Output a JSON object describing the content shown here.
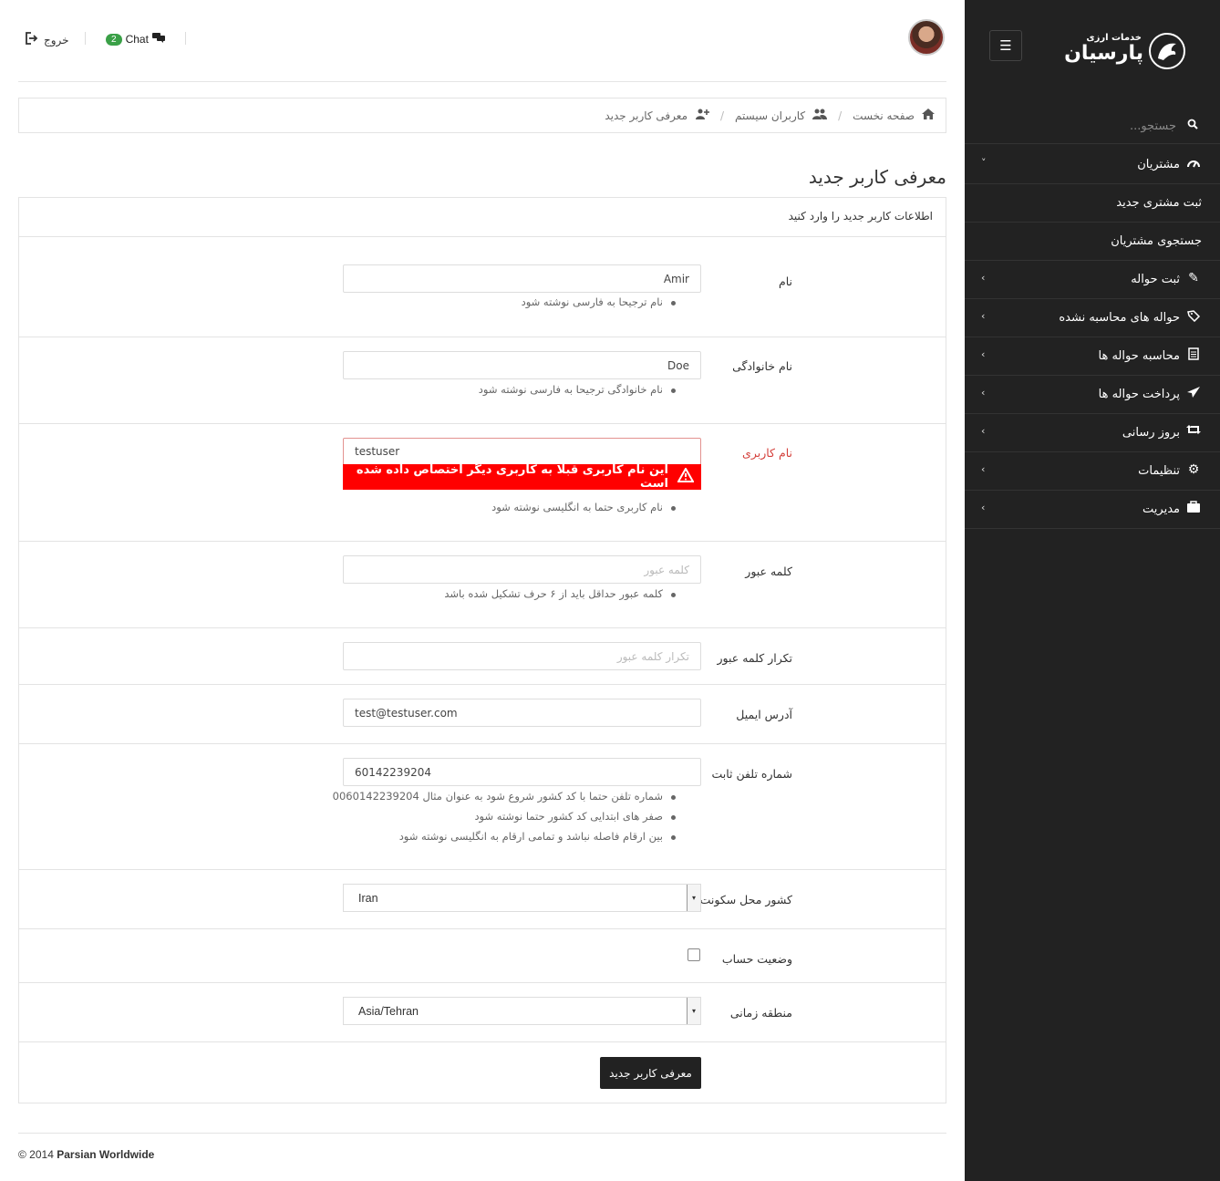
{
  "sidebar": {
    "logo_subtitle": "خدمات ارزی",
    "logo_title": "پارسیان",
    "search_placeholder": "جستجو...",
    "items": [
      {
        "label": "مشتریان",
        "icon": "dashboard-icon",
        "chevron": "˅"
      },
      {
        "label": "ثبت مشتری جدید"
      },
      {
        "label": "جستجوی مشتریان"
      },
      {
        "label": "ثبت حواله",
        "icon": "pencil-icon",
        "chevron": "‹"
      },
      {
        "label": "حواله های محاسبه نشده",
        "icon": "tags-icon",
        "chevron": "‹"
      },
      {
        "label": "محاسبه حواله ها",
        "icon": "list-alt-icon",
        "chevron": "‹"
      },
      {
        "label": "پرداخت حواله ها",
        "icon": "paper-plane-icon",
        "chevron": "‹"
      },
      {
        "label": "بروز رسانی",
        "icon": "retweet-icon",
        "chevron": "‹"
      },
      {
        "label": "تنظیمات",
        "icon": "cogs-icon",
        "chevron": "‹"
      },
      {
        "label": "مدیریت",
        "icon": "briefcase-icon",
        "chevron": "‹"
      }
    ]
  },
  "header": {
    "logout_label": "خروج",
    "chat_label": "Chat",
    "chat_count": "2"
  },
  "breadcrumb": {
    "home": "صفحه نخست",
    "users": "کاربران سیستم",
    "current": "معرفی کاربر جدید"
  },
  "page": {
    "title": "معرفی کاربر جدید",
    "panel_heading": "اطلاعات کاربر جدید را وارد کنید"
  },
  "form": {
    "first_name": {
      "label": "نام",
      "value": "Amir",
      "help": [
        "نام ترجیحا به فارسی نوشته شود"
      ]
    },
    "last_name": {
      "label": "نام خانوادگی",
      "value": "Doe",
      "help": [
        "نام خانوادگی ترجیحا به فارسی نوشته شود"
      ]
    },
    "username": {
      "label": "نام کاربری",
      "value": "testuser",
      "error": "این نام کاربری قبلا به کاربری دیگر اختصاص داده شده است",
      "help": [
        "نام کاربری حتما به انگلیسی نوشته شود"
      ]
    },
    "password": {
      "label": "کلمه عبور",
      "placeholder": "کلمه عبور",
      "help": [
        "کلمه عبور حداقل باید از ۶ حرف تشکیل شده باشد"
      ]
    },
    "password_repeat": {
      "label": "تکرار کلمه عبور",
      "placeholder": "تکرار کلمه عبور"
    },
    "email": {
      "label": "آدرس ایمیل",
      "value": "test@testuser.com"
    },
    "phone": {
      "label": "شماره تلفن ثابت",
      "value": "60142239204",
      "help": [
        "شماره تلفن حتما با کد کشور شروع شود به عنوان مثال 0060142239204",
        "صفر های ابتدایی کد کشور حتما نوشته شود",
        "بین ارقام فاصله نباشد و تمامی ارقام به انگلیسی نوشته شود"
      ]
    },
    "country": {
      "label": "کشور محل سکونت",
      "value": "Iran"
    },
    "account_status": {
      "label": "وضعیت حساب"
    },
    "timezone": {
      "label": "منطقه زمانی",
      "value": "Asia/Tehran"
    },
    "submit_label": "معرفی کاربر جدید"
  },
  "footer": {
    "copyright": "© 2014",
    "company": "Parsian Worldwide"
  },
  "colors": {
    "sidebar_bg": "#222222",
    "error_red": "#ff0000",
    "chat_badge": "#3aa047"
  }
}
